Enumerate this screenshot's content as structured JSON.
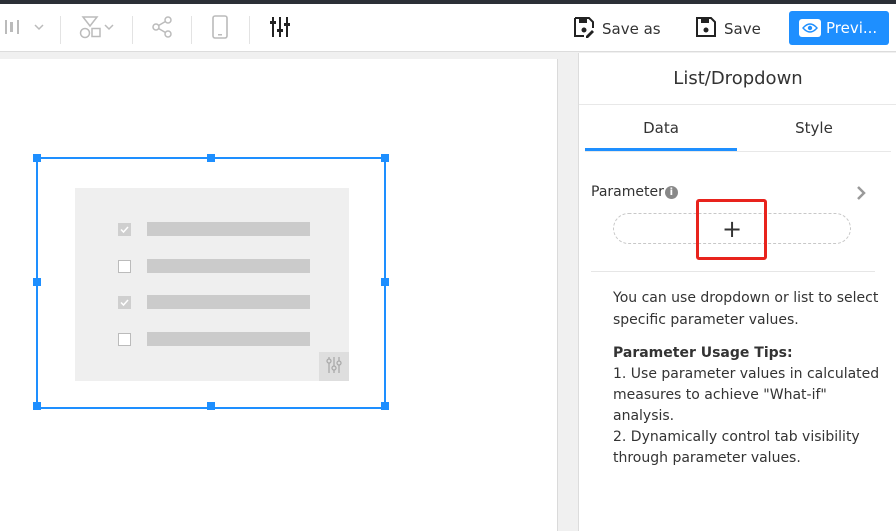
{
  "toolbar": {
    "save_as_label": "Save as",
    "save_label": "Save",
    "preview_label": "Previ...",
    "icons": [
      "align-icon",
      "shape-icon",
      "share-icon",
      "mobile-icon",
      "settings-sliders-icon"
    ],
    "colors": {
      "accent": "#1e8fff"
    }
  },
  "canvas": {
    "widget": {
      "rows": [
        {
          "checked": true
        },
        {
          "checked": false
        },
        {
          "checked": true
        },
        {
          "checked": false
        }
      ]
    }
  },
  "panel": {
    "title": "List/Dropdown",
    "tabs": [
      {
        "label": "Data",
        "active": true
      },
      {
        "label": "Style",
        "active": false
      }
    ],
    "parameter_label": "Parameter",
    "add_symbol": "+",
    "description": "You can use dropdown or list to select specific parameter values.",
    "tips_title": "Parameter Usage Tips:",
    "tips": [
      "1. Use parameter values in calculated measures to achieve \"What-if\" analysis.",
      "2. Dynamically control tab visibility through parameter values."
    ],
    "highlight_color": "#e8231d"
  }
}
